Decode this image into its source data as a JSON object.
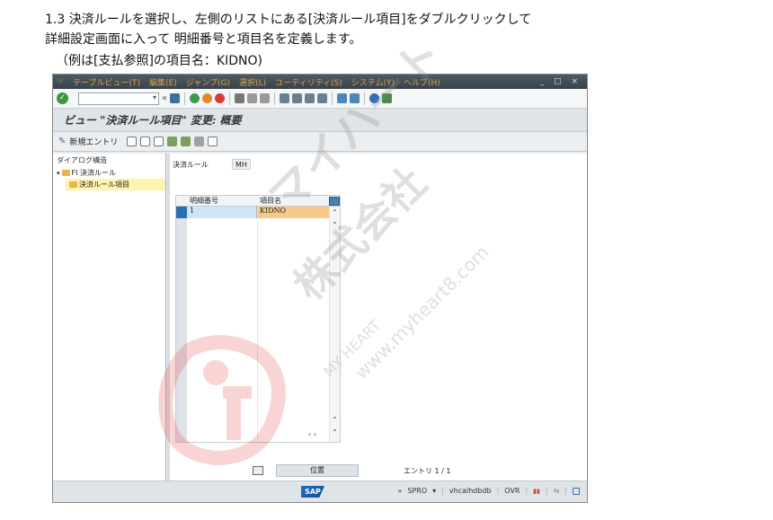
{
  "instructions": {
    "line1": "1.3 決済ルールを選択し、左側のリストにある[決済ルール項目]をダブルクリックして",
    "line2": "詳細設定画面に入って 明細番号と項目名を定義します。",
    "line3": "（例は[支払参照]の項目名：KIDNO)"
  },
  "menu": {
    "items": [
      "テーブルビュー(T)",
      "編集(E)",
      "ジャンプ(G)",
      "選択(L)",
      "ユーティリティ(S)",
      "システム(Y)",
      "ヘルプ(H)"
    ],
    "window_controls": "_ □ ×"
  },
  "toolbar": {
    "command_field": "",
    "back_chevron": "«"
  },
  "screen": {
    "title": "ビュー \"決済ルール項目\" 変更: 概要",
    "new_entries_label": "新規エントリ"
  },
  "tree": {
    "title": "ダイアログ構造",
    "node1": "FI 決済ルール",
    "node2": "決済ルール項目"
  },
  "detail": {
    "rule_label": "決済ルール",
    "rule_value": "MH",
    "col_item_no": "明細番号",
    "col_item_name": "項目名",
    "row1_no": "1",
    "row1_name": "KIDNO",
    "position_button": "位置",
    "entries": "エントリ 1 / 1"
  },
  "status": {
    "logo": "SAP",
    "transaction": "SPRO",
    "server": "vhcalhdbdb",
    "mode": "OVR"
  },
  "watermark": {
    "line1": "マイハート",
    "line2": "株式会社",
    "line3": "MY HEART",
    "url": "www.myheart8.com"
  },
  "colors": {
    "menubar": "#394249",
    "menu_text": "#d7a44a",
    "selected_row": "#2b6fb1",
    "row_name_highlight": "#f6c98a",
    "watermark_red": "#e23a3a"
  }
}
